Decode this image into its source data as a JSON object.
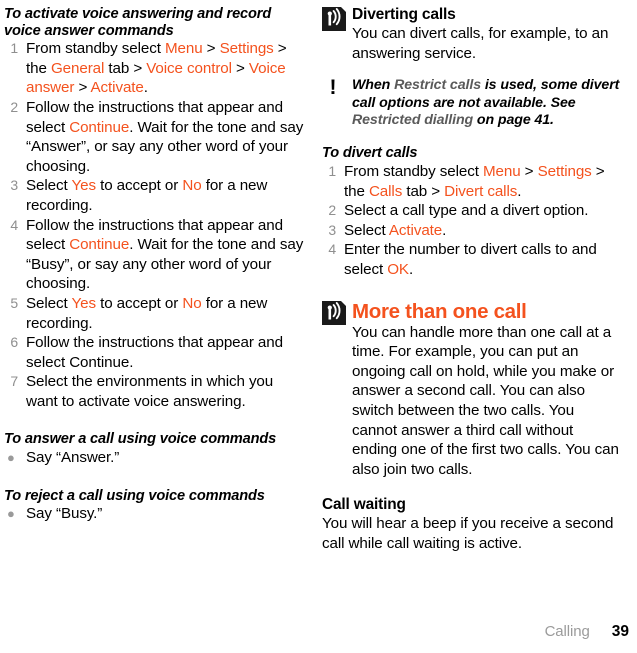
{
  "footer": {
    "chapter": "Calling",
    "page_number": "39"
  },
  "accent_color": "#F4521E",
  "left_column": {
    "proc1": {
      "heading": "To activate voice answering and record voice answer commands",
      "steps": [
        {
          "num": "1",
          "parts": [
            {
              "t": "From standby select ",
              "c": "black"
            },
            {
              "t": "Menu",
              "c": "orange"
            },
            {
              "t": " > ",
              "c": "black"
            },
            {
              "t": "Settings",
              "c": "orange"
            },
            {
              "t": " > the ",
              "c": "black"
            },
            {
              "t": "General",
              "c": "orange"
            },
            {
              "t": " tab > ",
              "c": "black"
            },
            {
              "t": "Voice control",
              "c": "orange"
            },
            {
              "t": " > ",
              "c": "black"
            },
            {
              "t": "Voice answer",
              "c": "orange"
            },
            {
              "t": " > ",
              "c": "black"
            },
            {
              "t": "Activate",
              "c": "orange"
            },
            {
              "t": ".",
              "c": "black"
            }
          ]
        },
        {
          "num": "2",
          "parts": [
            {
              "t": "Follow the instructions that appear and select ",
              "c": "black"
            },
            {
              "t": "Continue",
              "c": "orange"
            },
            {
              "t": ". Wait for the tone and say “Answer”, or say any other word of your choosing.",
              "c": "black"
            }
          ]
        },
        {
          "num": "3",
          "parts": [
            {
              "t": "Select ",
              "c": "black"
            },
            {
              "t": "Yes",
              "c": "orange"
            },
            {
              "t": " to accept or ",
              "c": "black"
            },
            {
              "t": "No",
              "c": "orange"
            },
            {
              "t": " for a new recording.",
              "c": "black"
            }
          ]
        },
        {
          "num": "4",
          "parts": [
            {
              "t": "Follow the instructions that appear and select ",
              "c": "black"
            },
            {
              "t": "Continue",
              "c": "orange"
            },
            {
              "t": ". Wait for the tone and say “Busy”, or say any other word of your choosing.",
              "c": "black"
            }
          ]
        },
        {
          "num": "5",
          "parts": [
            {
              "t": "Select ",
              "c": "black"
            },
            {
              "t": "Yes",
              "c": "orange"
            },
            {
              "t": " to accept or ",
              "c": "black"
            },
            {
              "t": "No",
              "c": "orange"
            },
            {
              "t": " for a new recording.",
              "c": "black"
            }
          ]
        },
        {
          "num": "6",
          "parts": [
            {
              "t": "Follow the instructions that appear and select Continue.",
              "c": "black"
            }
          ]
        },
        {
          "num": "7",
          "parts": [
            {
              "t": "Select the environments in which you want to activate voice answering.",
              "c": "black"
            }
          ]
        }
      ]
    },
    "proc2": {
      "heading": "To answer a call using voice commands",
      "bullets": [
        {
          "parts": [
            {
              "t": "Say “Answer.”",
              "c": "black"
            }
          ]
        }
      ]
    },
    "proc3": {
      "heading": "To reject a call using voice commands",
      "bullets": [
        {
          "parts": [
            {
              "t": "Say “Busy.”",
              "c": "black"
            }
          ]
        }
      ]
    }
  },
  "right_column": {
    "section_diverting": {
      "icon": "signal-antenna-icon",
      "title": "Diverting calls",
      "body": "You can divert calls, for example, to an answering service."
    },
    "note": {
      "icon": "exclamation-icon",
      "parts": [
        {
          "t": "When ",
          "c": "black"
        },
        {
          "t": "Restrict calls",
          "c": "gray"
        },
        {
          "t": " is used, some divert call options are not available. See ",
          "c": "black"
        },
        {
          "t": "Restricted dialling",
          "c": "gray"
        },
        {
          "t": " on page 41.",
          "c": "black"
        }
      ]
    },
    "proc_divert": {
      "heading": "To divert calls",
      "steps": [
        {
          "num": "1",
          "parts": [
            {
              "t": "From standby select ",
              "c": "black"
            },
            {
              "t": "Menu",
              "c": "orange"
            },
            {
              "t": " > ",
              "c": "black"
            },
            {
              "t": "Settings",
              "c": "orange"
            },
            {
              "t": " > the ",
              "c": "black"
            },
            {
              "t": "Calls",
              "c": "orange"
            },
            {
              "t": " tab > ",
              "c": "black"
            },
            {
              "t": "Divert calls",
              "c": "orange"
            },
            {
              "t": ".",
              "c": "black"
            }
          ]
        },
        {
          "num": "2",
          "parts": [
            {
              "t": "Select a call type and a divert option.",
              "c": "black"
            }
          ]
        },
        {
          "num": "3",
          "parts": [
            {
              "t": "Select ",
              "c": "black"
            },
            {
              "t": "Activate",
              "c": "orange"
            },
            {
              "t": ".",
              "c": "black"
            }
          ]
        },
        {
          "num": "4",
          "parts": [
            {
              "t": "Enter the number to divert calls to and select ",
              "c": "black"
            },
            {
              "t": "OK",
              "c": "orange"
            },
            {
              "t": ".",
              "c": "black"
            }
          ]
        }
      ]
    },
    "section_more": {
      "icon": "signal-antenna-icon",
      "title": "More than one call",
      "body": "You can handle more than one call at a time. For example, you can put an ongoing call on hold, while you make or answer a second call. You can also switch between the two calls. You cannot answer a third call without ending one of the first two calls. You can also join two calls."
    },
    "sub_call_waiting": {
      "title": "Call waiting",
      "body": "You will hear a beep if you receive a second call while call waiting is active."
    }
  }
}
